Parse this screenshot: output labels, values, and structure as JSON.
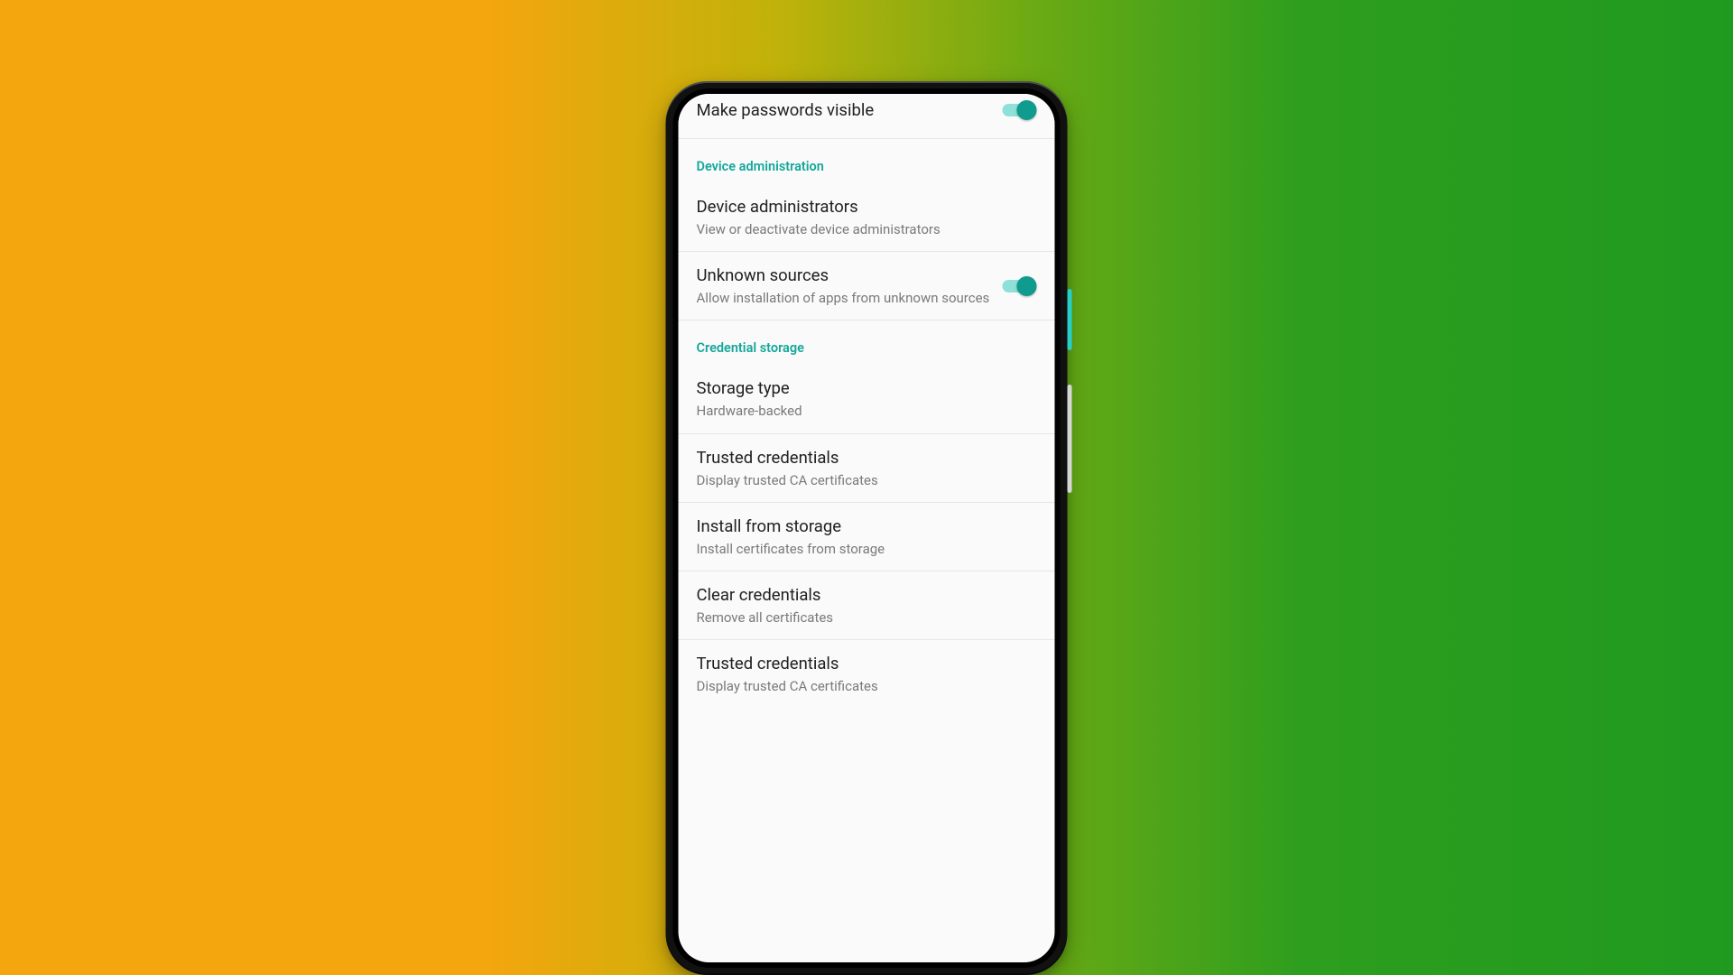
{
  "passwords": {
    "make_visible": {
      "title": "Make passwords visible",
      "on": true
    }
  },
  "device_admin": {
    "header": "Device administration",
    "admins": {
      "title": "Device administrators",
      "sub": "View or deactivate device administrators"
    },
    "unknown": {
      "title": "Unknown sources",
      "sub": "Allow installation of apps from unknown sources",
      "on": true
    }
  },
  "cred": {
    "header": "Credential storage",
    "storage": {
      "title": "Storage type",
      "sub": "Hardware-backed"
    },
    "trusted": {
      "title": "Trusted credentials",
      "sub": "Display trusted CA certificates"
    },
    "install": {
      "title": "Install from storage",
      "sub": "Install certificates from storage"
    },
    "clear": {
      "title": "Clear credentials",
      "sub": "Remove all certificates"
    },
    "trusted2": {
      "title": "Trusted credentials",
      "sub": "Display trusted CA certificates"
    }
  }
}
